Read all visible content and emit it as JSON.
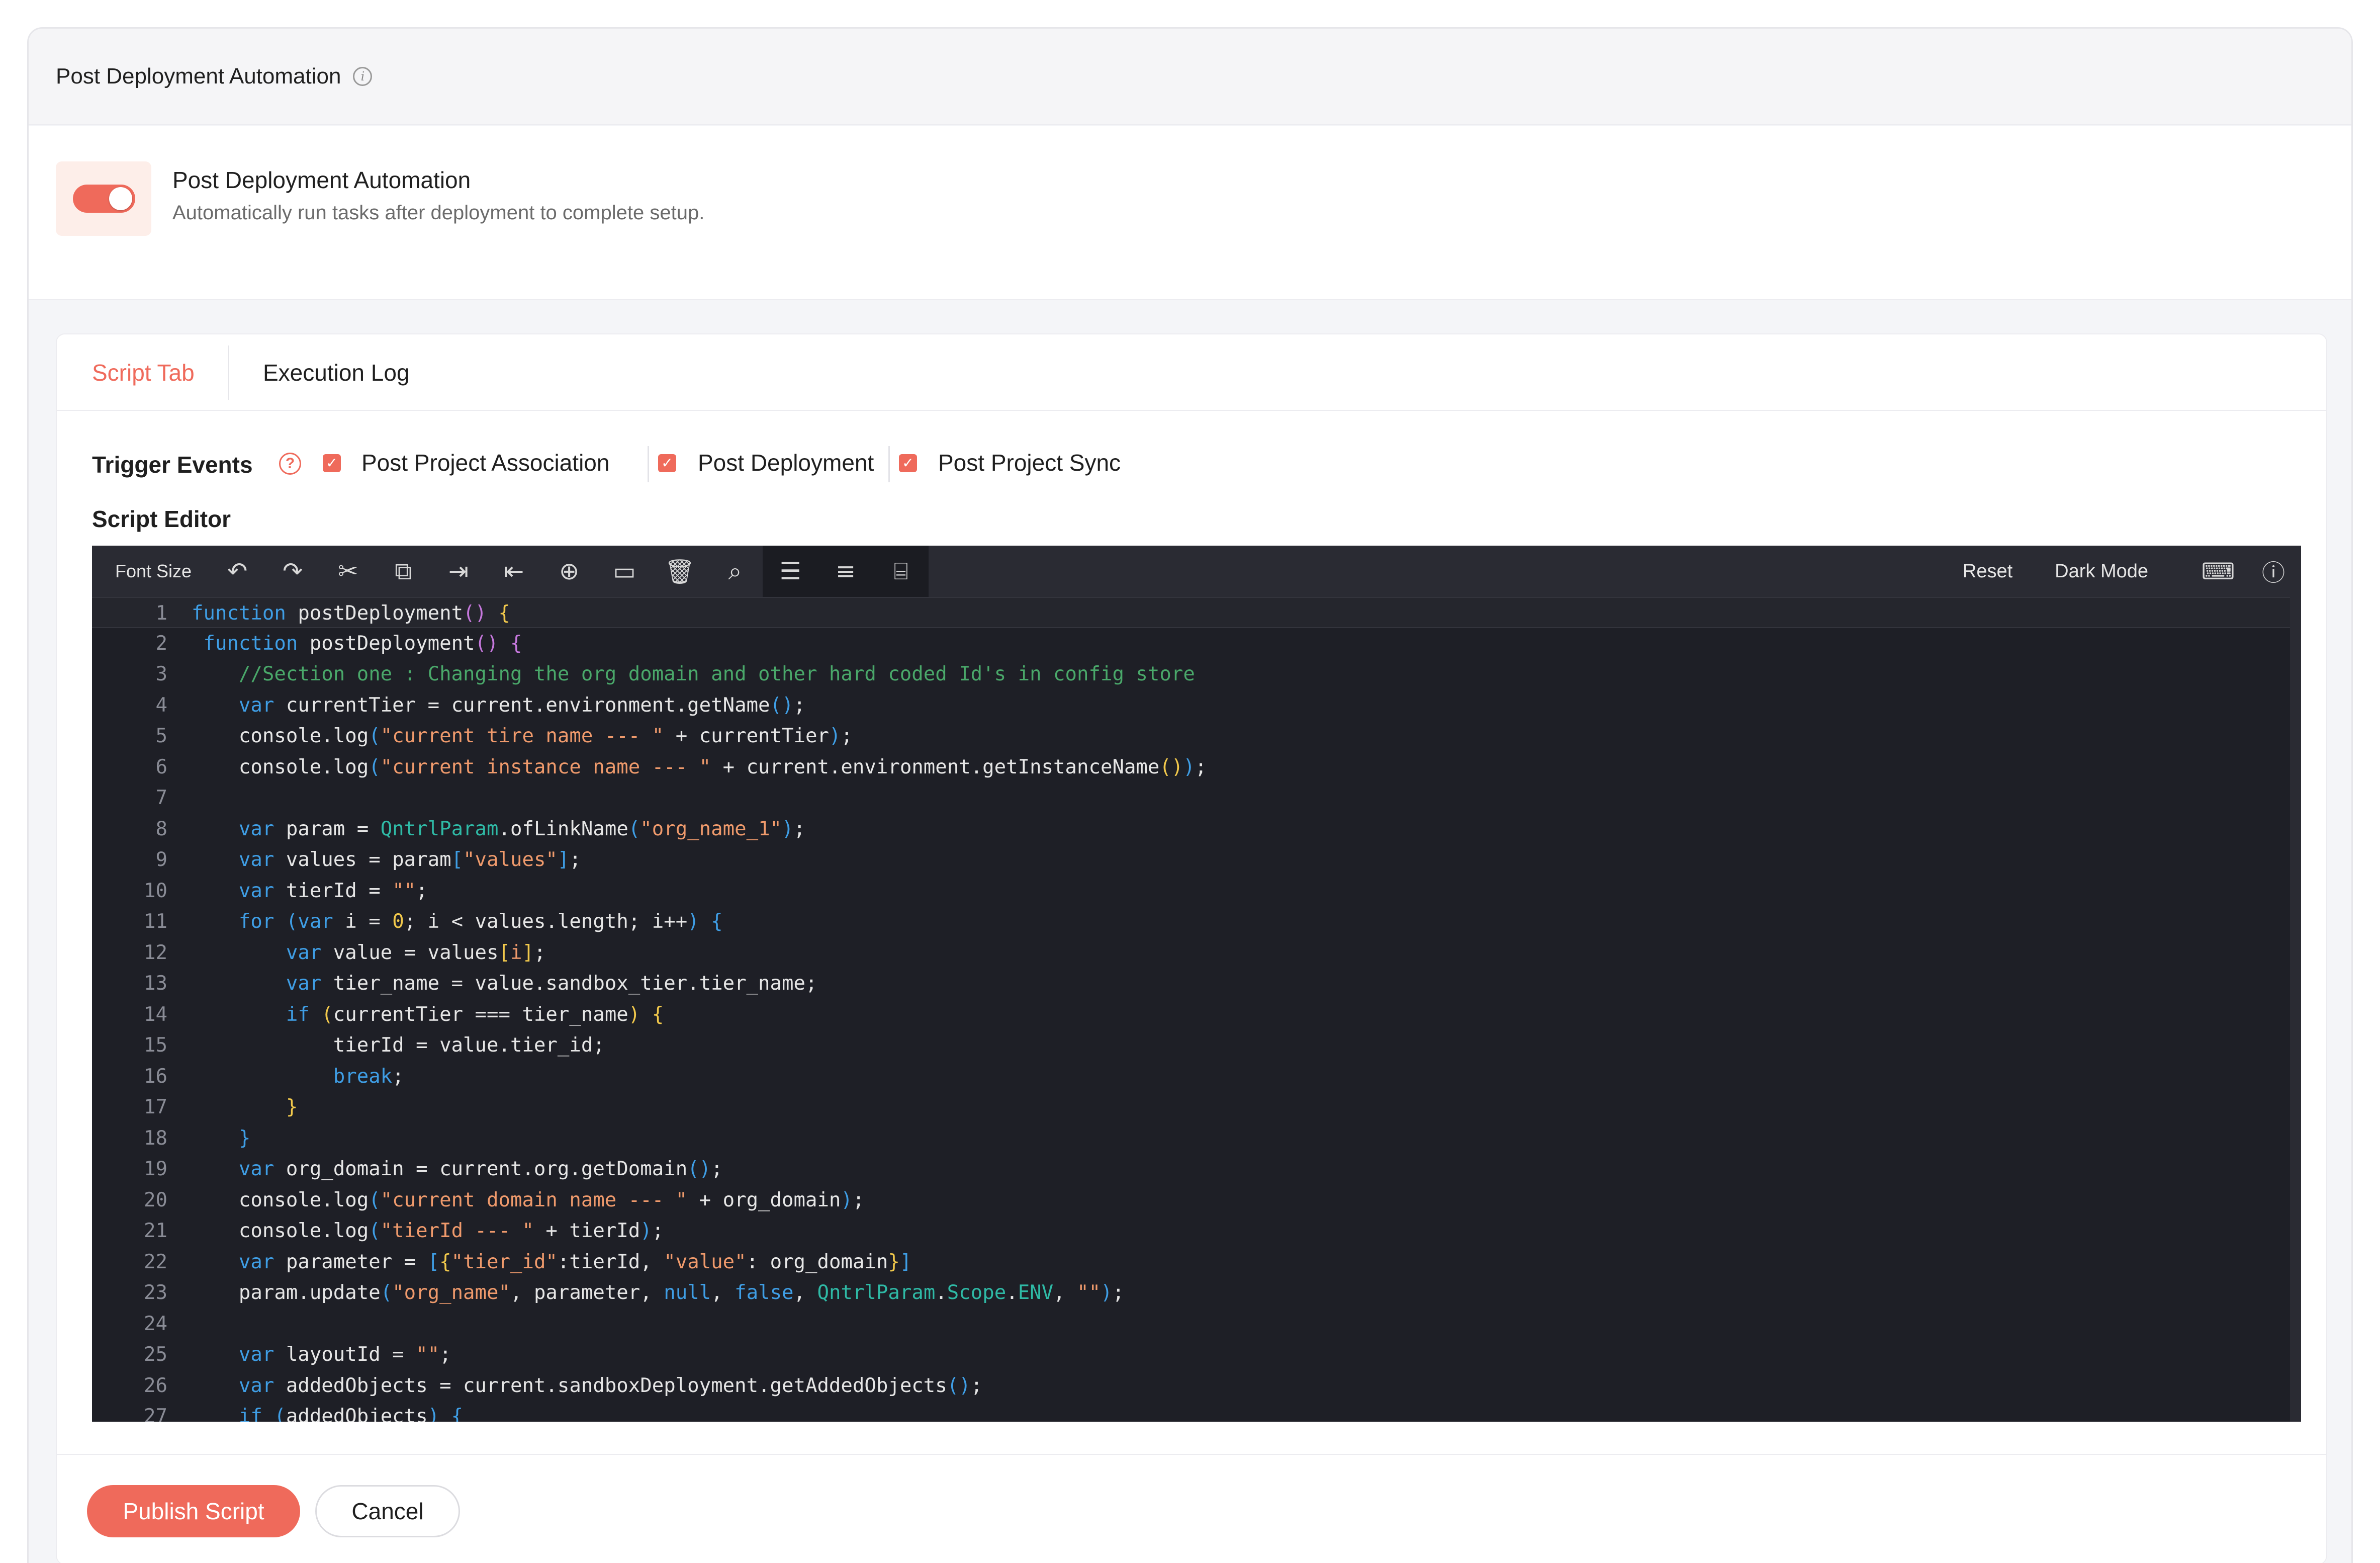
{
  "header": {
    "title": "Post Deployment Automation"
  },
  "toggle": {
    "title": "Post Deployment Automation",
    "description": "Automatically run tasks after deployment to complete setup.",
    "enabled": true
  },
  "tabs": [
    {
      "label": "Script Tab",
      "active": true
    },
    {
      "label": "Execution Log",
      "active": false
    }
  ],
  "trigger_events": {
    "label": "Trigger Events",
    "options": [
      {
        "label": "Post Project Association",
        "checked": true
      },
      {
        "label": "Post Deployment",
        "checked": true
      },
      {
        "label": "Post Project Sync",
        "checked": true
      }
    ]
  },
  "editor": {
    "title": "Script Editor",
    "toolbar": {
      "font_size_label": "Font Size",
      "reset_label": "Reset",
      "dark_mode_label": "Dark Mode"
    },
    "lines": [
      [
        {
          "t": "function",
          "c": "k"
        },
        {
          "t": " postDeployment",
          "c": "f"
        },
        {
          "t": "()",
          "c": "p"
        },
        {
          "t": " ",
          "c": "f"
        },
        {
          "t": "{",
          "c": "y"
        }
      ],
      [
        {
          "t": " function",
          "c": "k"
        },
        {
          "t": " postDeployment",
          "c": "f"
        },
        {
          "t": "()",
          "c": "p"
        },
        {
          "t": " ",
          "c": "f"
        },
        {
          "t": "{",
          "c": "p"
        }
      ],
      [
        {
          "t": "    //Section one : Changing the org domain and other hard coded Id's in config store",
          "c": "c"
        }
      ],
      [
        {
          "t": "    var",
          "c": "k"
        },
        {
          "t": " currentTier = current.environment.getName",
          "c": "f"
        },
        {
          "t": "()",
          "c": "k"
        },
        {
          "t": ";",
          "c": "f"
        }
      ],
      [
        {
          "t": "    console.log",
          "c": "f"
        },
        {
          "t": "(",
          "c": "k"
        },
        {
          "t": "\"current tire name --- \"",
          "c": "s"
        },
        {
          "t": " + currentTier",
          "c": "f"
        },
        {
          "t": ")",
          "c": "k"
        },
        {
          "t": ";",
          "c": "f"
        }
      ],
      [
        {
          "t": "    console.log",
          "c": "f"
        },
        {
          "t": "(",
          "c": "k"
        },
        {
          "t": "\"current instance name --- \"",
          "c": "s"
        },
        {
          "t": " + current.environment.getInstanceName",
          "c": "f"
        },
        {
          "t": "()",
          "c": "y"
        },
        {
          "t": ")",
          "c": "k"
        },
        {
          "t": ";",
          "c": "f"
        }
      ],
      [
        {
          "t": "",
          "c": "f"
        }
      ],
      [
        {
          "t": "    var",
          "c": "k"
        },
        {
          "t": " param = ",
          "c": "f"
        },
        {
          "t": "QntrlParam",
          "c": "t"
        },
        {
          "t": ".ofLinkName",
          "c": "f"
        },
        {
          "t": "(",
          "c": "k"
        },
        {
          "t": "\"org_name_1\"",
          "c": "s"
        },
        {
          "t": ")",
          "c": "k"
        },
        {
          "t": ";",
          "c": "f"
        }
      ],
      [
        {
          "t": "    var",
          "c": "k"
        },
        {
          "t": " values = param",
          "c": "f"
        },
        {
          "t": "[",
          "c": "k"
        },
        {
          "t": "\"values\"",
          "c": "s"
        },
        {
          "t": "]",
          "c": "k"
        },
        {
          "t": ";",
          "c": "f"
        }
      ],
      [
        {
          "t": "    var",
          "c": "k"
        },
        {
          "t": " tierId = ",
          "c": "f"
        },
        {
          "t": "\"\"",
          "c": "s"
        },
        {
          "t": ";",
          "c": "f"
        }
      ],
      [
        {
          "t": "    for",
          "c": "k"
        },
        {
          "t": " (",
          "c": "k"
        },
        {
          "t": "var",
          "c": "k"
        },
        {
          "t": " i = ",
          "c": "f"
        },
        {
          "t": "0",
          "c": "y"
        },
        {
          "t": "; i < values.length; i++",
          "c": "f"
        },
        {
          "t": ")",
          "c": "k"
        },
        {
          "t": " {",
          "c": "k"
        }
      ],
      [
        {
          "t": "        var",
          "c": "k"
        },
        {
          "t": " value = values",
          "c": "f"
        },
        {
          "t": "[",
          "c": "y"
        },
        {
          "t": "i",
          "c": "s"
        },
        {
          "t": "]",
          "c": "y"
        },
        {
          "t": ";",
          "c": "f"
        }
      ],
      [
        {
          "t": "        var",
          "c": "k"
        },
        {
          "t": " tier_name = value.sandbox_tier.tier_name;",
          "c": "f"
        }
      ],
      [
        {
          "t": "        if",
          "c": "k"
        },
        {
          "t": " (",
          "c": "y"
        },
        {
          "t": "currentTier === tier_name",
          "c": "f"
        },
        {
          "t": ")",
          "c": "y"
        },
        {
          "t": " {",
          "c": "y"
        }
      ],
      [
        {
          "t": "            tierId = value.tier_id;",
          "c": "f"
        }
      ],
      [
        {
          "t": "            break",
          "c": "k"
        },
        {
          "t": ";",
          "c": "f"
        }
      ],
      [
        {
          "t": "        }",
          "c": "y"
        }
      ],
      [
        {
          "t": "    }",
          "c": "k"
        }
      ],
      [
        {
          "t": "    var",
          "c": "k"
        },
        {
          "t": " org_domain = current.org.getDomain",
          "c": "f"
        },
        {
          "t": "()",
          "c": "k"
        },
        {
          "t": ";",
          "c": "f"
        }
      ],
      [
        {
          "t": "    console.log",
          "c": "f"
        },
        {
          "t": "(",
          "c": "k"
        },
        {
          "t": "\"current domain name --- \"",
          "c": "s"
        },
        {
          "t": " + org_domain",
          "c": "f"
        },
        {
          "t": ")",
          "c": "k"
        },
        {
          "t": ";",
          "c": "f"
        }
      ],
      [
        {
          "t": "    console.log",
          "c": "f"
        },
        {
          "t": "(",
          "c": "k"
        },
        {
          "t": "\"tierId --- \"",
          "c": "s"
        },
        {
          "t": " + tierId",
          "c": "f"
        },
        {
          "t": ")",
          "c": "k"
        },
        {
          "t": ";",
          "c": "f"
        }
      ],
      [
        {
          "t": "    var",
          "c": "k"
        },
        {
          "t": " parameter = ",
          "c": "f"
        },
        {
          "t": "[",
          "c": "k"
        },
        {
          "t": "{",
          "c": "y"
        },
        {
          "t": "\"tier_id\"",
          "c": "s"
        },
        {
          "t": ":tierId, ",
          "c": "f"
        },
        {
          "t": "\"value\"",
          "c": "s"
        },
        {
          "t": ": org_domain",
          "c": "f"
        },
        {
          "t": "}",
          "c": "y"
        },
        {
          "t": "]",
          "c": "k"
        }
      ],
      [
        {
          "t": "    param.update",
          "c": "f"
        },
        {
          "t": "(",
          "c": "k"
        },
        {
          "t": "\"org_name\"",
          "c": "s"
        },
        {
          "t": ", parameter, ",
          "c": "f"
        },
        {
          "t": "null",
          "c": "k"
        },
        {
          "t": ", ",
          "c": "f"
        },
        {
          "t": "false",
          "c": "k"
        },
        {
          "t": ", ",
          "c": "f"
        },
        {
          "t": "QntrlParam",
          "c": "t"
        },
        {
          "t": ".",
          "c": "f"
        },
        {
          "t": "Scope",
          "c": "t"
        },
        {
          "t": ".",
          "c": "f"
        },
        {
          "t": "ENV",
          "c": "t"
        },
        {
          "t": ", ",
          "c": "f"
        },
        {
          "t": "\"\"",
          "c": "s"
        },
        {
          "t": ")",
          "c": "k"
        },
        {
          "t": ";",
          "c": "f"
        }
      ],
      [
        {
          "t": "",
          "c": "f"
        }
      ],
      [
        {
          "t": "    var",
          "c": "k"
        },
        {
          "t": " layoutId = ",
          "c": "f"
        },
        {
          "t": "\"\"",
          "c": "s"
        },
        {
          "t": ";",
          "c": "f"
        }
      ],
      [
        {
          "t": "    var",
          "c": "k"
        },
        {
          "t": " addedObjects = current.sandboxDeployment.getAddedObjects",
          "c": "f"
        },
        {
          "t": "()",
          "c": "k"
        },
        {
          "t": ";",
          "c": "f"
        }
      ],
      [
        {
          "t": "    if",
          "c": "k"
        },
        {
          "t": " (",
          "c": "k"
        },
        {
          "t": "addedObjects",
          "c": "f"
        },
        {
          "t": ")",
          "c": "k"
        },
        {
          "t": " {",
          "c": "k"
        }
      ]
    ]
  },
  "footer": {
    "publish_label": "Publish Script",
    "cancel_label": "Cancel"
  }
}
